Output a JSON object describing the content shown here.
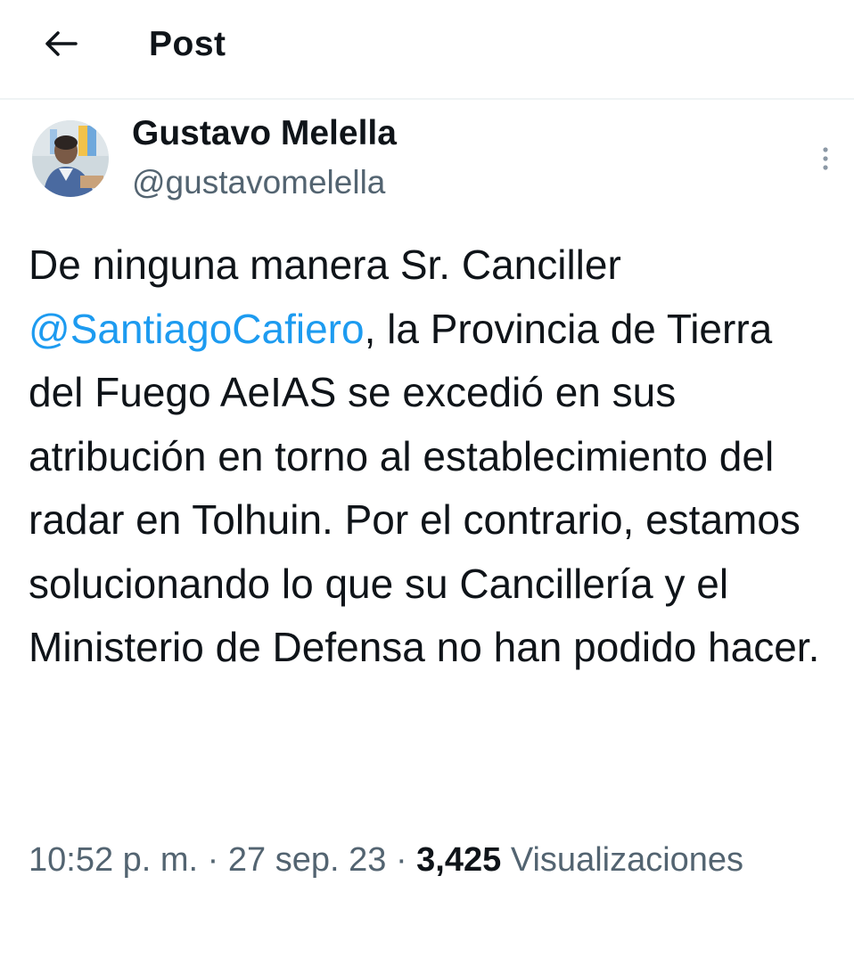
{
  "header": {
    "back_icon": "arrow-left-icon",
    "title": "Post"
  },
  "author": {
    "display_name": "Gustavo Melella",
    "handle": "@gustavomelella",
    "avatar_icon": "user-avatar",
    "more_icon": "more-vertical-icon"
  },
  "tweet": {
    "text_before": "De ninguna manera Sr. Canciller ",
    "mention": "@SantiagoCafiero",
    "text_after": ", la Provincia de Tierra del Fuego AeIAS se excedió en sus atribución en torno al establecimiento del radar en Tolhuin. Por el contrario, estamos solucionando lo que su Cancillería y el Ministerio de Defensa no han podido hacer."
  },
  "meta": {
    "time": "10:52 p. m.",
    "separator": " · ",
    "date": "27 sep. 23",
    "views_count": "3,425",
    "views_label": "Visualizaciones"
  },
  "colors": {
    "text": "#0f1419",
    "secondary": "#536471",
    "link": "#1d9bf0",
    "divider": "#eff3f4"
  }
}
